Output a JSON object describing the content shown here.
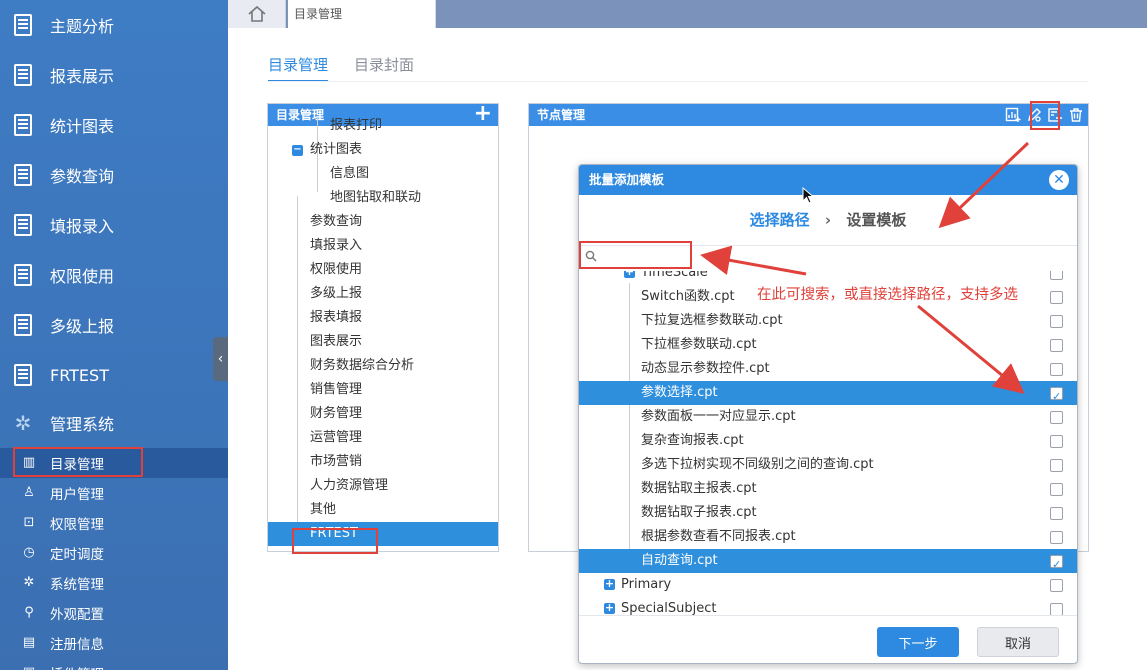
{
  "sidebar": {
    "items": [
      {
        "label": "主题分析"
      },
      {
        "label": "报表展示"
      },
      {
        "label": "统计图表"
      },
      {
        "label": "参数查询"
      },
      {
        "label": "填报录入"
      },
      {
        "label": "权限使用"
      },
      {
        "label": "多级上报"
      },
      {
        "label": "FRTEST"
      }
    ],
    "admin": {
      "label": "管理系统"
    },
    "sub_items": [
      {
        "label": "目录管理",
        "icon": "chart-icon"
      },
      {
        "label": "用户管理",
        "icon": "user-icon"
      },
      {
        "label": "权限管理",
        "icon": "lock-icon"
      },
      {
        "label": "定时调度",
        "icon": "clock-icon"
      },
      {
        "label": "系统管理",
        "icon": "gear-icon"
      },
      {
        "label": "外观配置",
        "icon": "brush-icon"
      },
      {
        "label": "注册信息",
        "icon": "register-icon"
      },
      {
        "label": "插件管理",
        "icon": "plugin-icon"
      }
    ]
  },
  "topbar": {
    "tab_label": "目录管理"
  },
  "main": {
    "tabs": [
      {
        "label": "目录管理"
      },
      {
        "label": "目录封面"
      }
    ],
    "dir_panel": {
      "title": "目录管理",
      "tree": [
        {
          "label": "报表打印"
        },
        {
          "label": "统计图表"
        },
        {
          "label": "信息图"
        },
        {
          "label": "地图钻取和联动"
        },
        {
          "label": "参数查询"
        },
        {
          "label": "填报录入"
        },
        {
          "label": "权限使用"
        },
        {
          "label": "多级上报"
        },
        {
          "label": "报表填报"
        },
        {
          "label": "图表展示"
        },
        {
          "label": "财务数据综合分析"
        },
        {
          "label": "销售管理"
        },
        {
          "label": "财务管理"
        },
        {
          "label": "运营管理"
        },
        {
          "label": "市场营销"
        },
        {
          "label": "人力资源管理"
        },
        {
          "label": "其他"
        },
        {
          "label": "FRTEST"
        }
      ]
    },
    "node_panel": {
      "title": "节点管理"
    }
  },
  "modal": {
    "title": "批量添加模板",
    "step1": "选择路径",
    "step_sep": "›",
    "step2": "设置模板",
    "search_placeholder": "",
    "rows": [
      {
        "label": "TimeScale",
        "checked": false
      },
      {
        "label": "Switch函数.cpt",
        "checked": false
      },
      {
        "label": "下拉复选框参数联动.cpt",
        "checked": false
      },
      {
        "label": "下拉框参数联动.cpt",
        "checked": false
      },
      {
        "label": "动态显示参数控件.cpt",
        "checked": false
      },
      {
        "label": "参数选择.cpt",
        "checked": true
      },
      {
        "label": "参数面板一一对应显示.cpt",
        "checked": false
      },
      {
        "label": "复杂查询报表.cpt",
        "checked": false
      },
      {
        "label": "多选下拉树实现不同级别之间的查询.cpt",
        "checked": false
      },
      {
        "label": "数据钻取主报表.cpt",
        "checked": false
      },
      {
        "label": "数据钻取子报表.cpt",
        "checked": false
      },
      {
        "label": "根据参数查看不同报表.cpt",
        "checked": false
      },
      {
        "label": "自动查询.cpt",
        "checked": true
      },
      {
        "label": "Primary",
        "checked": false
      },
      {
        "label": "SpecialSubject",
        "checked": false
      }
    ],
    "next_label": "下一步",
    "cancel_label": "取消"
  },
  "annotation": {
    "text": "在此可搜索，或直接选择路径，支持多选",
    "color": "#e0413a"
  }
}
